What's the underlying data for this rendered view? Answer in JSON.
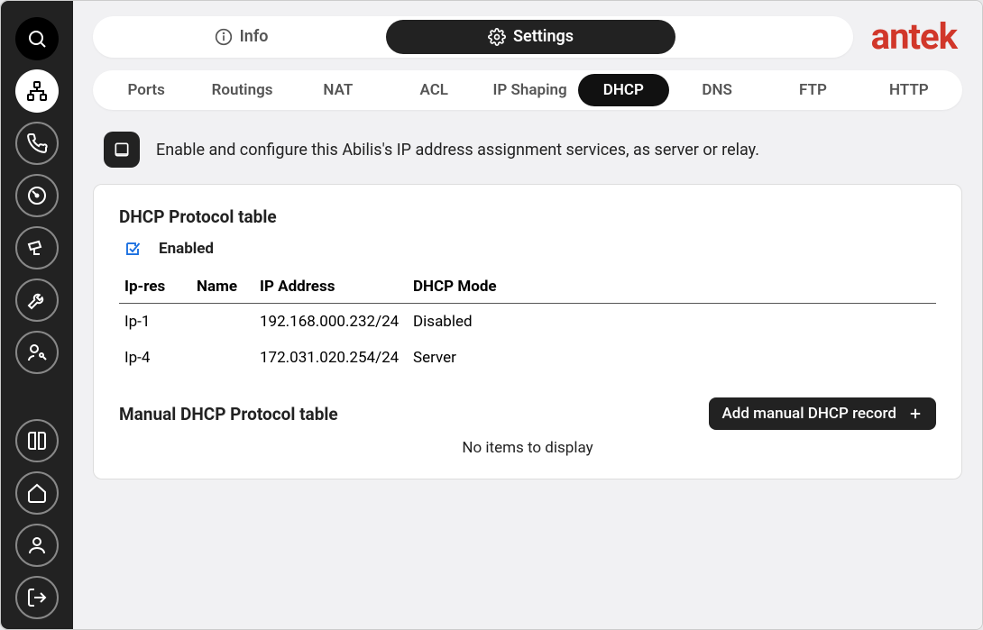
{
  "brand": "antek",
  "top_tabs": {
    "info": "Info",
    "settings": "Settings"
  },
  "sub_tabs": [
    "Ports",
    "Routings",
    "NAT",
    "ACL",
    "IP Shaping",
    "DHCP",
    "DNS",
    "FTP",
    "HTTP"
  ],
  "active_sub_tab": "DHCP",
  "description": "Enable and configure this Abilis's IP address assignment services, as server or relay.",
  "dhcp_card": {
    "title": "DHCP Protocol table",
    "enabled_label": "Enabled",
    "columns": {
      "ipres": "Ip-res",
      "name": "Name",
      "ip": "IP Address",
      "mode": "DHCP Mode"
    },
    "rows": [
      {
        "ipres": "Ip-1",
        "name": "",
        "ip": "192.168.000.232/24",
        "mode": "Disabled"
      },
      {
        "ipres": "Ip-4",
        "name": "",
        "ip": "172.031.020.254/24",
        "mode": "Server"
      }
    ],
    "manual_title": "Manual DHCP Protocol table",
    "add_button": "Add manual DHCP record",
    "no_items": "No items to display"
  }
}
